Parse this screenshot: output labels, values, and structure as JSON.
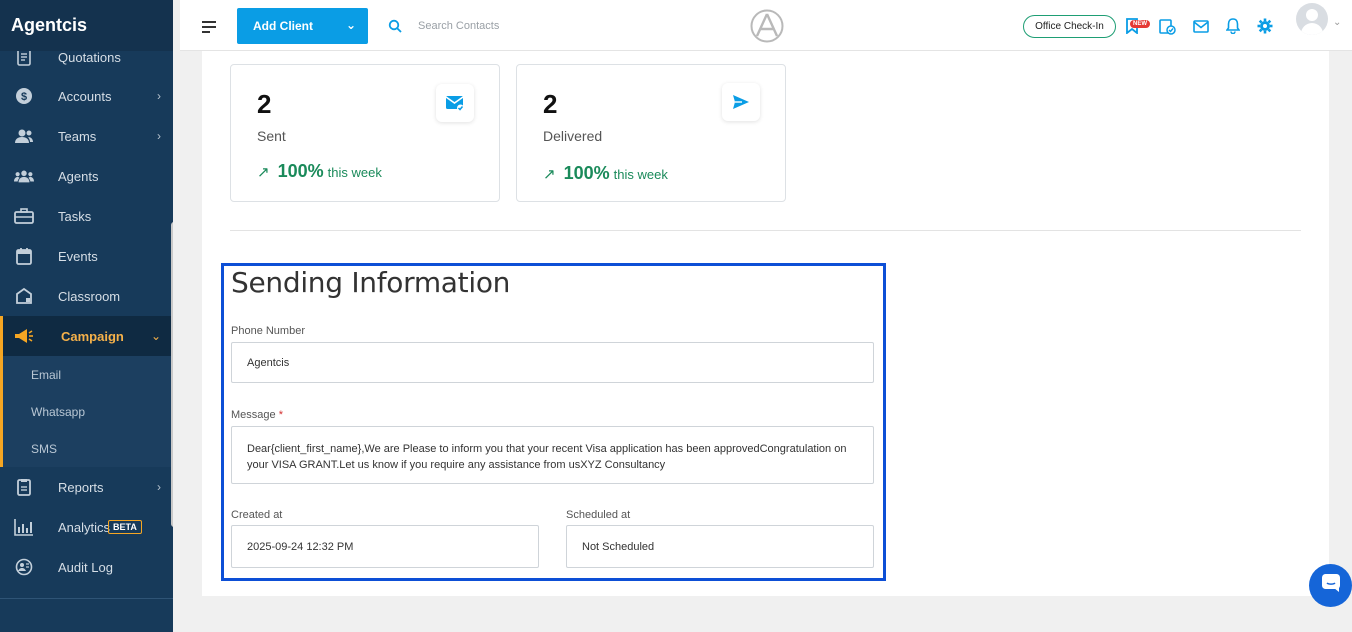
{
  "app": {
    "brand": "Agentcis"
  },
  "sidebar": {
    "items": [
      {
        "label": "Quotations",
        "icon": "document-icon",
        "chevron": false
      },
      {
        "label": "Accounts",
        "icon": "dollar-icon",
        "chevron": true
      },
      {
        "label": "Teams",
        "icon": "team-icon",
        "chevron": true
      },
      {
        "label": "Agents",
        "icon": "agents-icon",
        "chevron": false
      },
      {
        "label": "Tasks",
        "icon": "briefcase-icon",
        "chevron": false
      },
      {
        "label": "Events",
        "icon": "calendar-icon",
        "chevron": false
      },
      {
        "label": "Classroom",
        "icon": "classroom-icon",
        "chevron": false
      },
      {
        "label": "Campaign",
        "icon": "megaphone-icon",
        "chevron": true,
        "active": true
      },
      {
        "label": "Reports",
        "icon": "report-icon",
        "chevron": true
      },
      {
        "label": "Analytics",
        "icon": "analytics-icon",
        "chevron": false,
        "badge": "BETA"
      },
      {
        "label": "Audit Log",
        "icon": "audit-log-icon",
        "chevron": false
      }
    ],
    "campaign_sub": [
      "Email",
      "Whatsapp",
      "SMS"
    ]
  },
  "topbar": {
    "add_client": "Add Client",
    "search_placeholder": "Search Contacts",
    "office_checkin": "Office Check-In",
    "new_badge": "NEW"
  },
  "stats": [
    {
      "value": "2",
      "label": "Sent",
      "pct": "100%",
      "period": "this week",
      "icon": "mail-check-icon"
    },
    {
      "value": "2",
      "label": "Delivered",
      "pct": "100%",
      "period": "this week",
      "icon": "send-icon"
    }
  ],
  "sending": {
    "title": "Sending Information",
    "phone_label": "Phone Number",
    "phone_value": "Agentcis",
    "message_label": "Message",
    "message_required": "*",
    "message_value": "Dear{client_first_name},We are Please to inform you that your recent Visa application has been approvedCongratulation on your VISA GRANT.Let us know if you require any assistance from usXYZ Consultancy",
    "created_label": "Created at",
    "created_value": "2025-09-24 12:32 PM",
    "scheduled_label": "Scheduled at",
    "scheduled_value": "Not Scheduled"
  },
  "colors": {
    "accent": "#0a9de5",
    "sidebar": "#173a5a",
    "active": "#f5a623",
    "success": "#1a8a5a",
    "highlight": "#0d4fd6"
  }
}
